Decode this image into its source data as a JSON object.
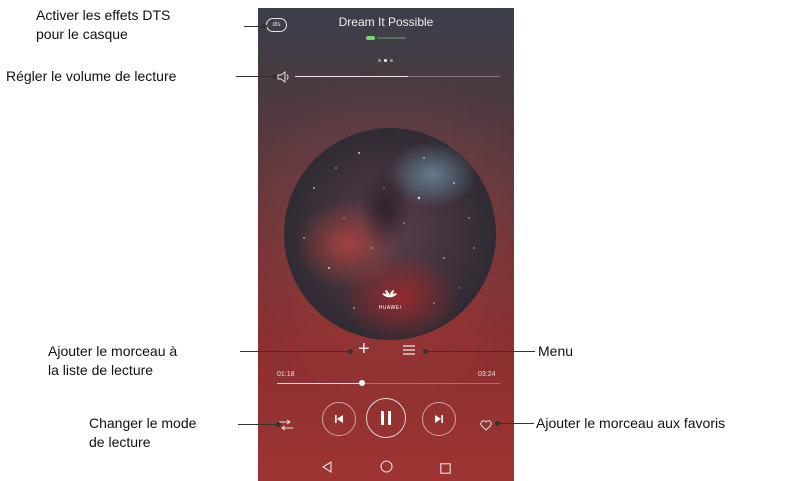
{
  "player": {
    "dts_label": "dts",
    "song_title": "Dream It Possible",
    "volume_level": 0.55,
    "brand_label": "HUAWEI",
    "time_elapsed": "01:18",
    "time_total": "03:24",
    "progress": 0.38
  },
  "icons": {
    "dts": "dts-icon",
    "volume": "speaker-icon",
    "add": "plus-icon",
    "menu": "menu-icon",
    "mode": "shuffle-icon",
    "prev": "skip-previous-icon",
    "play_pause": "pause-icon",
    "next": "skip-next-icon",
    "favorite": "heart-icon",
    "nav_back": "back-triangle-icon",
    "nav_home": "home-circle-icon",
    "nav_recent": "recent-square-icon"
  },
  "colors": {
    "artist_green": "#76d872",
    "background_top": "#3b3f4a",
    "background_bottom": "#9d3433"
  },
  "annotations": {
    "dts_line1": "Activer les effets DTS",
    "dts_line2": "pour le casque",
    "volume": "Régler le volume de lecture",
    "add_line1": "Ajouter le morceau à",
    "add_line2": "la liste de lecture",
    "menu": "Menu",
    "mode_line1": "Changer le mode",
    "mode_line2": "de lecture",
    "favorite": "Ajouter le morceau aux favoris"
  }
}
